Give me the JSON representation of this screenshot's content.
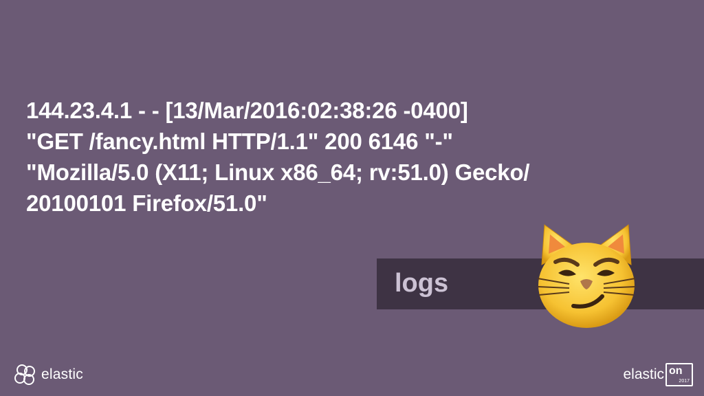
{
  "log": {
    "lines": [
      "144.23.4.1 - - [13/Mar/2016:02:38:26 -0400]",
      "\"GET /fancy.html HTTP/1.1\" 200 6146 \"-\"",
      "\"Mozilla/5.0 (X11; Linux x86_64; rv:51.0) Gecko/",
      "20100101 Firefox/51.0\""
    ]
  },
  "label": {
    "text": "logs"
  },
  "emoji": {
    "icon": "smirking-cat-icon"
  },
  "footer": {
    "left_brand": "elastic",
    "left_icon": "elastic-logo-icon",
    "right_brand": "elastic",
    "right_on": "on",
    "right_year": "2017"
  },
  "colors": {
    "background": "#6b5a75",
    "band": "#3e3344",
    "label": "#ccc2d4",
    "text": "#ffffff",
    "cat": "#f6c232"
  }
}
